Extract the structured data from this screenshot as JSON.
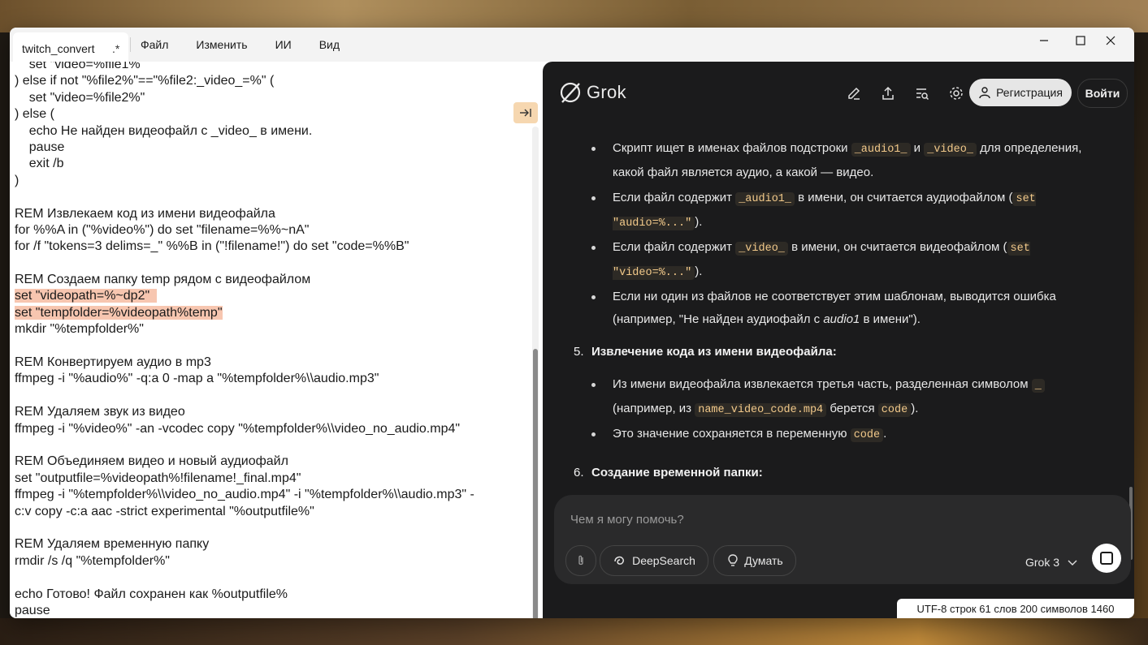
{
  "window": {
    "tab_title": "twitch_convert",
    "tab_dirty": ".*",
    "menu": [
      "Файл",
      "Изменить",
      "ИИ",
      "Вид"
    ],
    "controls": {
      "minimize": "—",
      "maximize": "☐",
      "close": "✕"
    }
  },
  "editor": {
    "lines": [
      {
        "text": "    set \"video=%file1%",
        "hl": false
      },
      {
        "text": ") else if not \"%file2%\"==\"%file2:_video_=%\" (",
        "hl": false
      },
      {
        "text": "    set \"video=%file2%\"",
        "hl": false
      },
      {
        "text": ") else (",
        "hl": false
      },
      {
        "text": "    echo Не найден видеофайл с _video_ в имени.",
        "hl": false
      },
      {
        "text": "    pause",
        "hl": false
      },
      {
        "text": "    exit /b",
        "hl": false
      },
      {
        "text": ")",
        "hl": false
      },
      {
        "text": "",
        "hl": false
      },
      {
        "text": "REM Извлекаем код из имени видеофайла",
        "hl": false
      },
      {
        "text": "for %%A in (\"%video%\") do set \"filename=%%~nA\"",
        "hl": false
      },
      {
        "text": "for /f \"tokens=3 delims=_\" %%B in (\"!filename!\") do set \"code=%%B\"",
        "hl": false
      },
      {
        "text": "",
        "hl": false
      },
      {
        "text": "REM Создаем папку temp рядом с видеофайлом",
        "hl": false
      },
      {
        "text": "set \"videopath=%~dp2\"  ",
        "hl": true
      },
      {
        "text": "set \"tempfolder=%videopath%temp\"",
        "hl": true
      },
      {
        "text": "mkdir \"%tempfolder%\"",
        "hl": false
      },
      {
        "text": "",
        "hl": false
      },
      {
        "text": "REM Конвертируем аудио в mp3",
        "hl": false
      },
      {
        "text": "ffmpeg -i \"%audio%\" -q:a 0 -map a \"%tempfolder%\\\\audio.mp3\"",
        "hl": false
      },
      {
        "text": "",
        "hl": false
      },
      {
        "text": "REM Удаляем звук из видео",
        "hl": false
      },
      {
        "text": "ffmpeg -i \"%video%\" -an -vcodec copy \"%tempfolder%\\\\video_no_audio.mp4\"",
        "hl": false
      },
      {
        "text": "",
        "hl": false
      },
      {
        "text": "REM Объединяем видео и новый аудиофайл",
        "hl": false
      },
      {
        "text": "set \"outputfile=%videopath%!filename!_final.mp4\"",
        "hl": false
      },
      {
        "text": "ffmpeg -i \"%tempfolder%\\\\video_no_audio.mp4\" -i \"%tempfolder%\\\\audio.mp3\" -",
        "hl": false
      },
      {
        "text": "c:v copy -c:a aac -strict experimental \"%outputfile%\"",
        "hl": false
      },
      {
        "text": "",
        "hl": false
      },
      {
        "text": "REM Удаляем временную папку",
        "hl": false
      },
      {
        "text": "rmdir /s /q \"%tempfolder%\"",
        "hl": false
      },
      {
        "text": "",
        "hl": false
      },
      {
        "text": "echo Готово! Файл сохранен как %outputfile%",
        "hl": false
      },
      {
        "text": "pause",
        "hl": false
      }
    ],
    "collapse_icon": "→|"
  },
  "grok": {
    "logo": "Grok",
    "icons": [
      "edit-icon",
      "share-icon",
      "search-history-icon",
      "settings-icon"
    ],
    "register_label": "Регистрация",
    "login_label": "Войти",
    "b1": {
      "t1": "Скрипт ищет в именах файлов подстроки ",
      "c1": "_audio1_",
      "t2": " и ",
      "c2": "_video_",
      "t3": " для определения, какой файл является аудио, а какой — видео."
    },
    "b2": {
      "t1": "Если файл содержит ",
      "c1": "_audio1_",
      "t2": " в имени, он считается аудиофайлом (",
      "c2": "set \"audio=%...\"",
      "t3": ")."
    },
    "b3": {
      "t1": "Если файл содержит ",
      "c1": "_video_",
      "t2": " в имени, он считается видеофайлом (",
      "c2": "set \"video=%...\"",
      "t3": ")."
    },
    "b4": {
      "t1": "Если ни один из файлов не соответствует этим шаблонам, выводится ошибка (например, \"Не найден аудиофайл с ",
      "em": "audio1",
      "t2": " в имени\")."
    },
    "h5": {
      "num": "5.",
      "text": "Извлечение кода из имени видеофайла:"
    },
    "b5": {
      "t1": "Из имени видеофайла извлекается третья часть, разделенная символом ",
      "c1": "_",
      "t2": " (например, из ",
      "c2": "name_video_code.mp4",
      "t3": " берется ",
      "c3": "code",
      "t4": ")."
    },
    "b6": {
      "t1": "Это значение сохраняется в переменную ",
      "c1": "code",
      "t2": "."
    },
    "h6": {
      "num": "6.",
      "text": "Создание временной папки:"
    },
    "composer": {
      "placeholder": "Чем я могу помочь?",
      "deepsearch": "DeepSearch",
      "think": "Думать",
      "model": "Grok 3"
    }
  },
  "status": {
    "encoding": "UTF-8",
    "lines_label": "строк",
    "lines": "61",
    "words_label": "слов",
    "words": "200",
    "chars_label": "символов",
    "chars": "1460"
  }
}
